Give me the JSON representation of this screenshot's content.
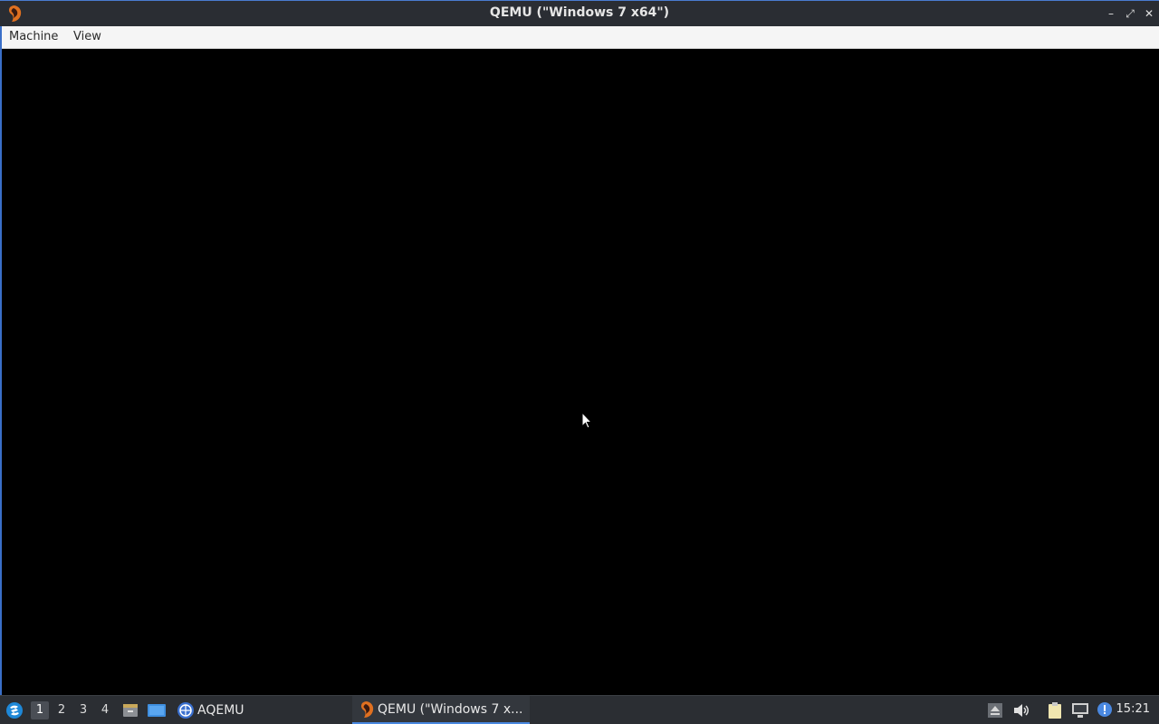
{
  "window": {
    "title": "QEMU (\"Windows 7 x64\")",
    "controls": {
      "minimize": "–",
      "maximize": "⤢",
      "close": "✕"
    }
  },
  "menubar": {
    "items": [
      "Machine",
      "View"
    ]
  },
  "taskbar": {
    "desktops": [
      "1",
      "2",
      "3",
      "4"
    ],
    "active_desktop": "1",
    "launcher_label": "AQEMU",
    "active_task_label": "QEMU (\"Windows 7 x...",
    "clock": "15:21"
  },
  "colors": {
    "titlebar": "#2a2d33",
    "accent": "#4a88e0",
    "display": "#000000",
    "taskbar": "#2b2e33"
  },
  "icons": {
    "app": "qemu-icon",
    "start": "start-menu-icon",
    "files": "file-manager-icon",
    "show_desktop": "desktop-icon",
    "aqemu": "aqemu-icon",
    "eject": "eject-icon",
    "volume": "volume-icon",
    "clipboard": "clipboard-icon",
    "network": "network-icon",
    "notification": "notification-icon"
  }
}
